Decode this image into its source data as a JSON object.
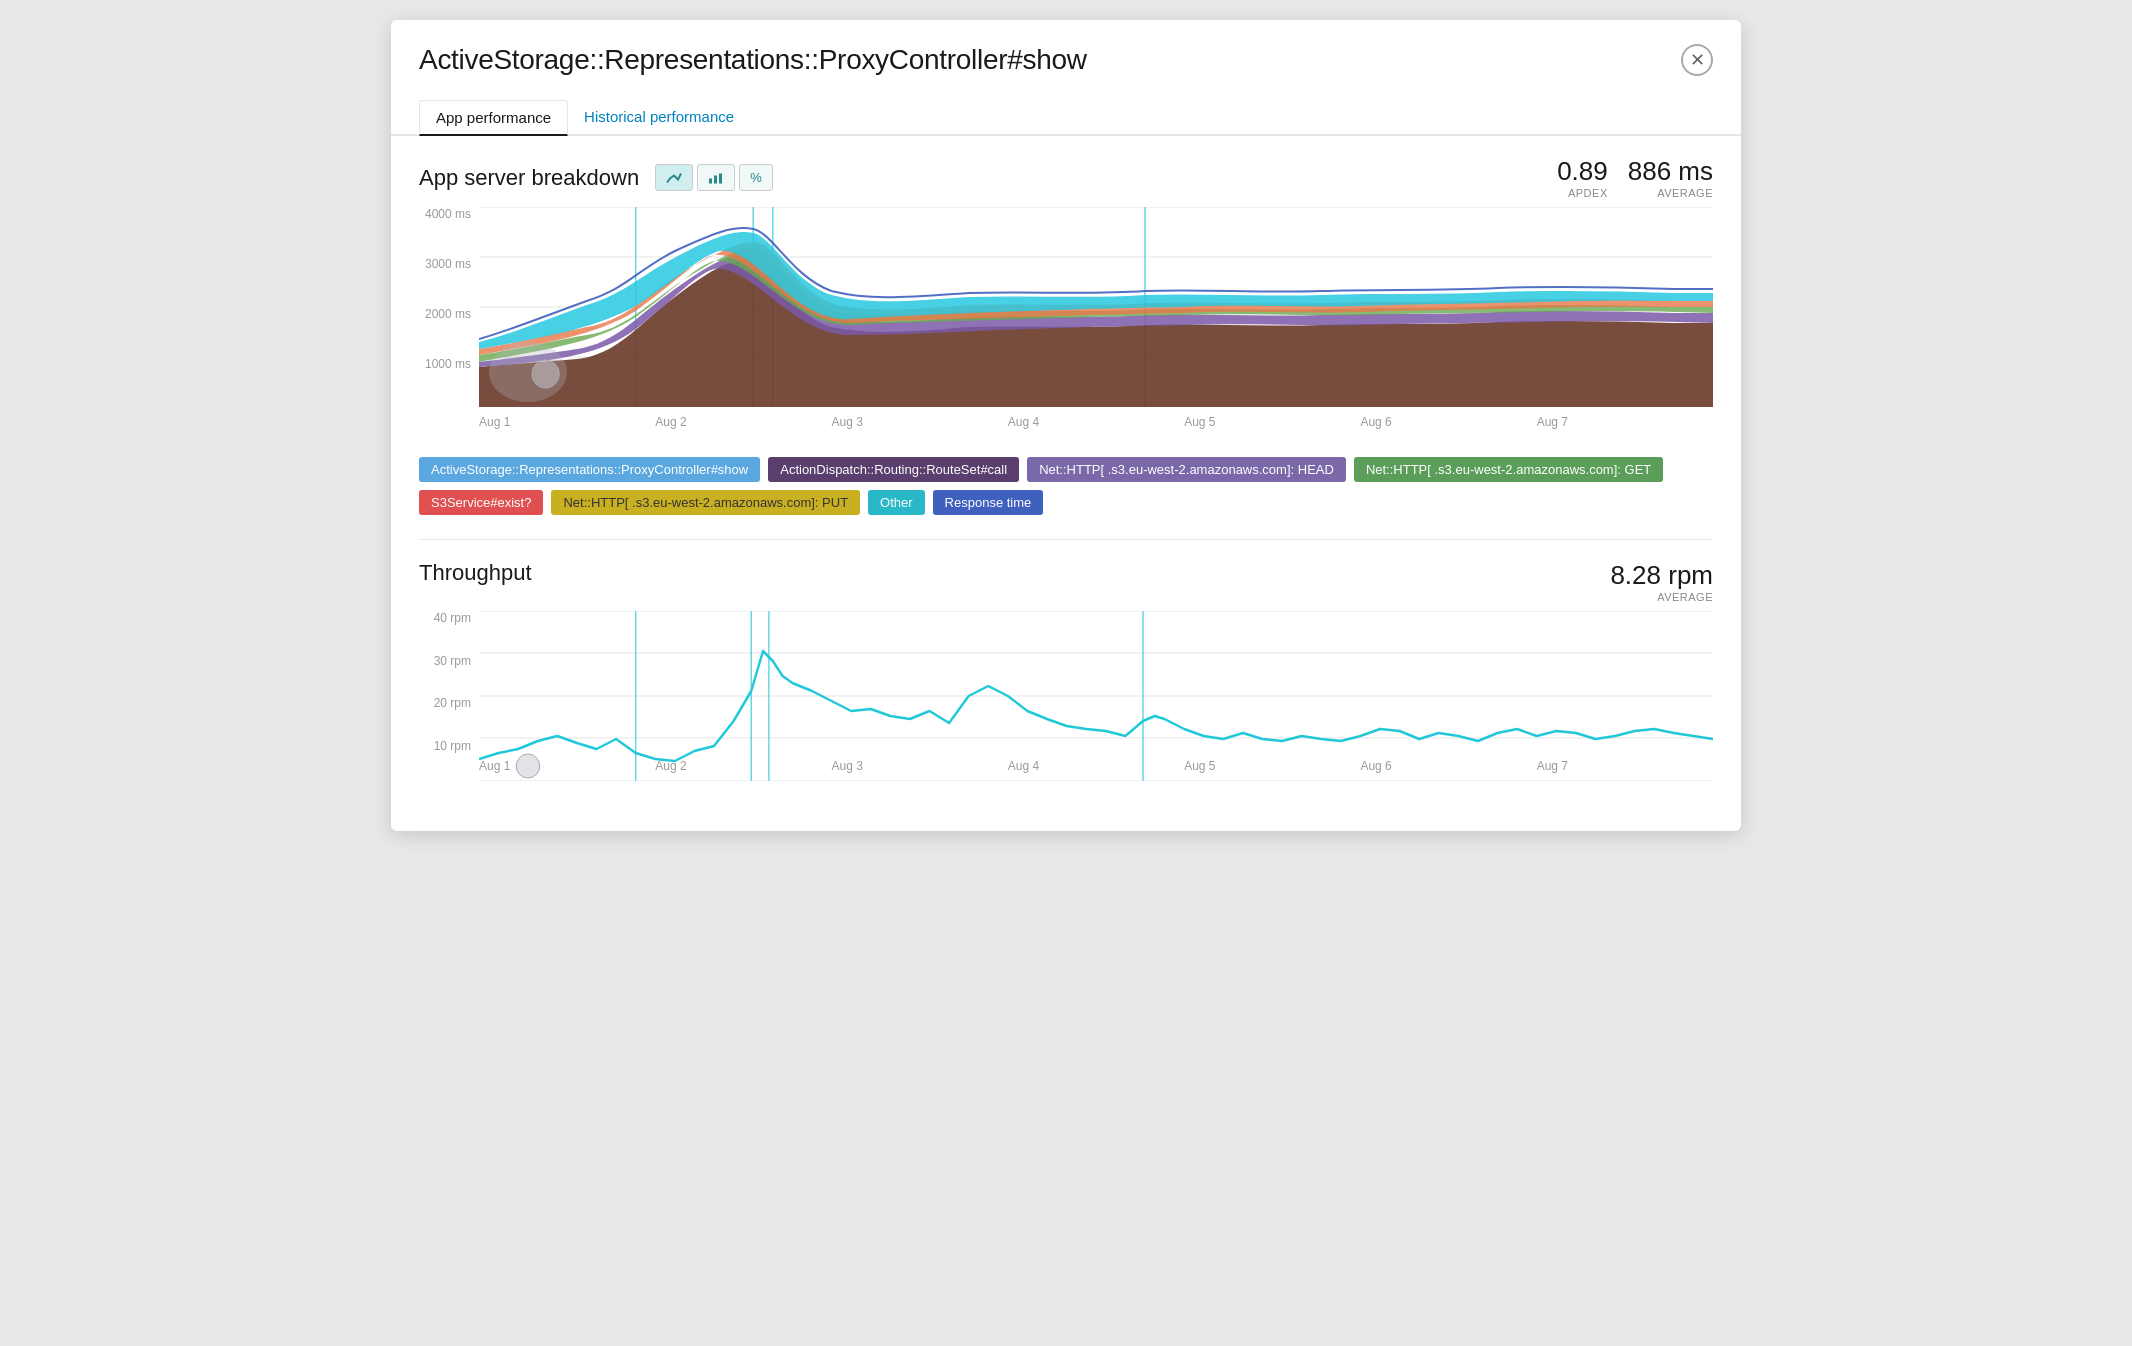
{
  "modal": {
    "title": "ActiveStorage::Representations::ProxyController#show",
    "close_label": "×"
  },
  "tabs": [
    {
      "id": "app-performance",
      "label": "App performance",
      "active": true
    },
    {
      "id": "historical-performance",
      "label": "Historical performance",
      "active": false
    }
  ],
  "app_server_breakdown": {
    "title": "App server breakdown",
    "apdex_label": "APDEX",
    "apdex_value": "0.89",
    "average_label": "AVERAGE",
    "average_value": "886 ms",
    "chart_buttons": [
      {
        "id": "line",
        "label": "📈",
        "active": true
      },
      {
        "id": "bar",
        "label": "📊",
        "active": false
      },
      {
        "id": "percent",
        "label": "%",
        "active": false
      }
    ],
    "y_labels": [
      "4000 ms",
      "3000 ms",
      "2000 ms",
      "1000 ms",
      ""
    ],
    "x_labels": [
      "Aug 1",
      "Aug 2",
      "Aug 3",
      "Aug 4",
      "Aug 5",
      "Aug 6",
      "Aug 7",
      ""
    ]
  },
  "legend": [
    {
      "id": "proxy-controller",
      "label": "ActiveStorage::Representations::ProxyController#show",
      "color": "#5ba8e0"
    },
    {
      "id": "action-dispatch",
      "label": "ActionDispatch::Routing::RouteSet#call",
      "color": "#5a3e6e"
    },
    {
      "id": "net-http-head",
      "label": "Net::HTTP[          .s3.eu-west-2.amazonaws.com]: HEAD",
      "color": "#7b68a8"
    },
    {
      "id": "net-http-get",
      "label": "Net::HTTP[          .s3.eu-west-2.amazonaws.com]: GET",
      "color": "#5a9e5a"
    },
    {
      "id": "s3service",
      "label": "S3Service#exist?",
      "color": "#e05050"
    },
    {
      "id": "net-http-put",
      "label": "Net::HTTP[          .s3.eu-west-2.amazonaws.com]: PUT",
      "color": "#c8b020"
    },
    {
      "id": "other",
      "label": "Other",
      "color": "#28b8c8"
    },
    {
      "id": "response-time",
      "label": "Response time",
      "color": "#4060c0"
    }
  ],
  "throughput": {
    "title": "Throughput",
    "average_label": "AVERAGE",
    "average_value": "8.28 rpm",
    "y_labels": [
      "40 rpm",
      "30 rpm",
      "20 rpm",
      "10 rpm",
      ""
    ],
    "x_labels": [
      "Aug 1",
      "Aug 2",
      "Aug 3",
      "Aug 4",
      "Aug 5",
      "Aug 6",
      "Aug 7",
      ""
    ]
  }
}
